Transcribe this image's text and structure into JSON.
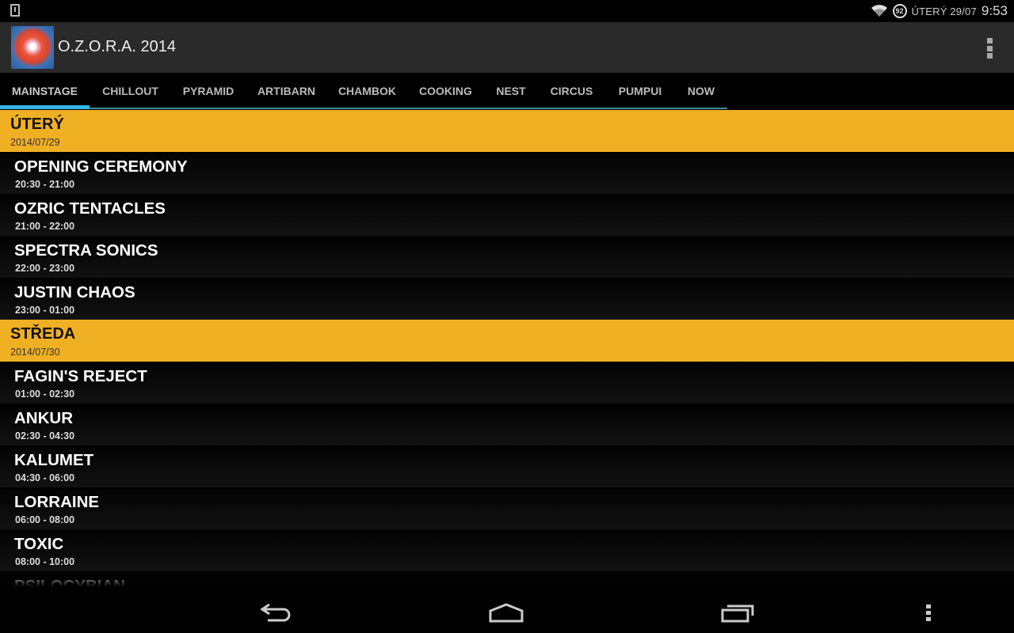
{
  "status_bar": {
    "notification_icon": "download-notification-icon",
    "wifi_icon": "wifi-icon",
    "battery_level": "92",
    "date": "ÚTERÝ 29/07",
    "time": "9:53"
  },
  "action_bar": {
    "app_icon": "ozora-logo-icon",
    "title": "O.Z.O.R.A. 2014",
    "overflow_icon": "overflow-menu-icon"
  },
  "tabs": {
    "selected": "MAINSTAGE",
    "items": [
      {
        "label": "MAINSTAGE"
      },
      {
        "label": "CHILLOUT"
      },
      {
        "label": "PYRAMID"
      },
      {
        "label": "ARTIBARN"
      },
      {
        "label": "CHAMBOK"
      },
      {
        "label": "COOKING"
      },
      {
        "label": "NEST"
      },
      {
        "label": "CIRCUS"
      },
      {
        "label": "PUMPUI"
      },
      {
        "label": "NOW"
      }
    ]
  },
  "schedule": {
    "accent_color": "#f0b023",
    "days": [
      {
        "name": "ÚTERÝ",
        "date": "2014/07/29",
        "events": [
          {
            "title": "OPENING CEREMONY",
            "time": "20:30 - 21:00"
          },
          {
            "title": "OZRIC TENTACLES",
            "time": "21:00 - 22:00"
          },
          {
            "title": "SPECTRA SONICS",
            "time": "22:00 - 23:00"
          },
          {
            "title": "JUSTIN CHAOS",
            "time": "23:00 - 01:00"
          }
        ]
      },
      {
        "name": "STŘEDA",
        "date": "2014/07/30",
        "events": [
          {
            "title": "FAGIN'S REJECT",
            "time": "01:00 - 02:30"
          },
          {
            "title": "ANKUR",
            "time": "02:30 - 04:30"
          },
          {
            "title": "KALUMET",
            "time": "04:30 - 06:00"
          },
          {
            "title": "LORRAINE",
            "time": "06:00 - 08:00"
          },
          {
            "title": "TOXIC",
            "time": "08:00 - 10:00"
          },
          {
            "title": "PSILOCYBIAN",
            "time": ""
          }
        ]
      }
    ]
  },
  "nav_bar": {
    "back_icon": "back-icon",
    "home_icon": "home-icon",
    "recents_icon": "recent-apps-icon",
    "menu_icon": "menu-icon"
  }
}
